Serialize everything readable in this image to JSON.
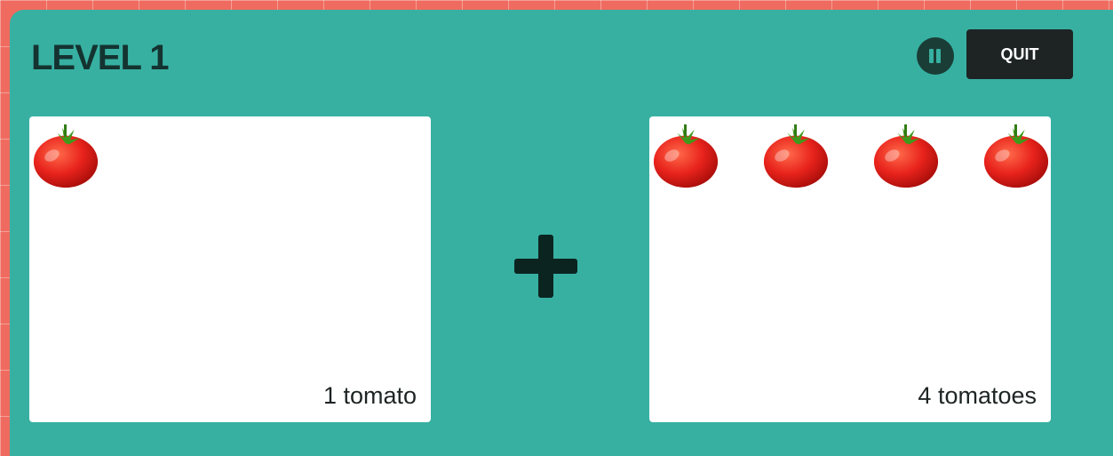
{
  "game": {
    "level_title": "LEVEL 1",
    "quit_label": "QUIT",
    "operator": "plus-icon",
    "left_group": {
      "count": 1,
      "label": "1 tomato",
      "item_icon": "tomato-icon"
    },
    "right_group": {
      "count": 4,
      "label": "4 tomatoes",
      "item_icon": "tomato-icon"
    }
  },
  "colors": {
    "frame": "#ef6b5f",
    "panel": "#37b0a2",
    "title_text": "#143330",
    "quit_button": "#1e2424",
    "tomato": "#e8231c",
    "leaf": "#3f9a1c"
  }
}
